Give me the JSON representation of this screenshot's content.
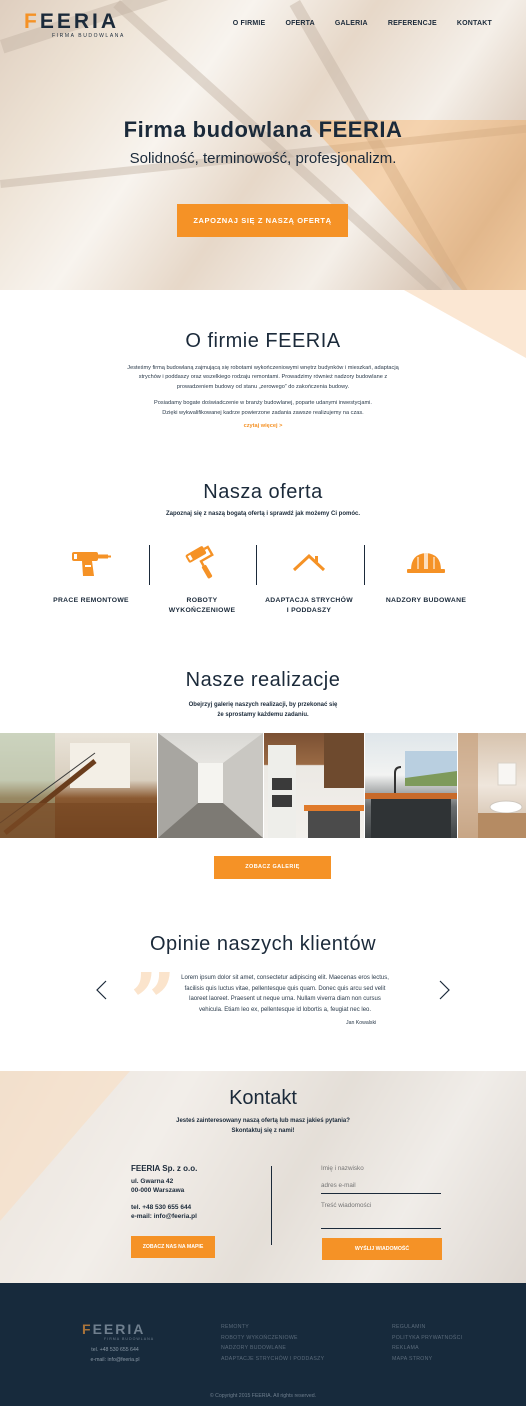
{
  "brand": {
    "logo_text": "FEERIA",
    "logo_sub": "FIRMA BUDOWLANA"
  },
  "nav": {
    "items": [
      "O FIRMIE",
      "OFERTA",
      "GALERIA",
      "REFERENCJE",
      "KONTAKT"
    ]
  },
  "hero": {
    "title": "Firma budowlana FEERIA",
    "tagline": "Solidność, terminowość, profesjonalizm.",
    "cta": "ZAPOZNAJ SIĘ Z NASZĄ OFERTĄ"
  },
  "about": {
    "title": "O firmie FEERIA",
    "para1_l1": "Jesteśmy firmą budowlaną zajmującą się robotami wykończeniowymi wnętrz budynków i mieszkań, adaptacją",
    "para1_l2": "strychów i poddaszy oraz wszelkiego rodzaju remontami. Prowadzimy również nadzory budowlane z",
    "para1_l3": "prowadzeniem budowy od stanu „zerowego” do zakończenia budowy.",
    "para2_l1": "Posiadamy bogate doświadczenie w branży budowlanej, poparte udanymi inwestycjami.",
    "para2_l2": "Dzięki wykwalifikowanej kadrze powierzone zadania zawsze realizujemy na czas.",
    "more": "czytaj więcej >"
  },
  "offer": {
    "title": "Nasza oferta",
    "subtitle": "Zapoznaj się z naszą bogatą ofertą i sprawdź jak możemy Ci pomóc.",
    "items": [
      {
        "icon": "drill-icon",
        "l1": "PRACE REMONTOWE",
        "l2": ""
      },
      {
        "icon": "paint-roller-icon",
        "l1": "ROBOTY",
        "l2": "WYKOŃCZENIOWE"
      },
      {
        "icon": "roof-icon",
        "l1": "ADAPTACJA STRYCHÓW",
        "l2": "I PODDASZY"
      },
      {
        "icon": "helmet-icon",
        "l1": "NADZORY BUDOWANE",
        "l2": ""
      }
    ]
  },
  "gallery": {
    "title": "Nasze realizacje",
    "subtitle_l1": "Obejrzyj galerię naszych realizacji, by przekonać się",
    "subtitle_l2": "że sprostamy każdemu zadaniu.",
    "button": "ZOBACZ GALERIĘ"
  },
  "opinions": {
    "title": "Opinie naszych klientów",
    "quote_l1": "Lorem ipsum dolor sit amet, consectetur adipiscing elit. Maecenas eros lectus,",
    "quote_l2": "facilisis quis luctus vitae, pellentesque quis quam. Donec quis arcu sed velit",
    "quote_l3": "laoreet laoreet. Praesent ut neque urna. Nullam viverra diam non cursus",
    "quote_l4": "vehicula. Etiam leo ex, pellentesque id lobortis a, feugiat nec leo.",
    "author": "Jan Kowalski"
  },
  "contact": {
    "title": "Kontakt",
    "subtitle_l1": "Jesteś zainteresowany naszą ofertą lub masz jakieś pytania?",
    "subtitle_l2": "Skontaktuj się z nami!",
    "company": "FEERIA Sp. z o.o.",
    "street": "ul. Gwarna 42",
    "city": "00-000 Warszawa",
    "phone": "tel. +48 530 655 644",
    "email": "e-mail: info@feeria.pl",
    "map_button": "ZOBACZ NAS NA MAPIE",
    "name_placeholder": "Imię i nazwisko",
    "email_placeholder": "adres e-mail",
    "message_placeholder": "Treść wiadomości",
    "send_button": "WYŚLIJ WIADOMOŚĆ"
  },
  "footer": {
    "logo_text": "FEERIA",
    "logo_sub": "FIRMA BUDOWLANA",
    "phone": "tel. +48 530 655 644",
    "email": "e-mail: info@feeria.pl",
    "col1": [
      "REMONTY",
      "ROBOTY WYKOŃCZENIOWE",
      "NADZORY BUDOWLANE",
      "ADAPTACJE STRYCHÓW I PODDASZY"
    ],
    "col2": [
      "REGULAMIN",
      "POLITYKA PRYWATNOŚCI",
      "REKLAMA",
      "MAPA STRONY"
    ],
    "copyright": "© Copyright 2015 FEERIA. All rights reserved."
  },
  "colors": {
    "accent": "#f59226",
    "navy": "#172a3c",
    "text": "#1b2a3a"
  }
}
